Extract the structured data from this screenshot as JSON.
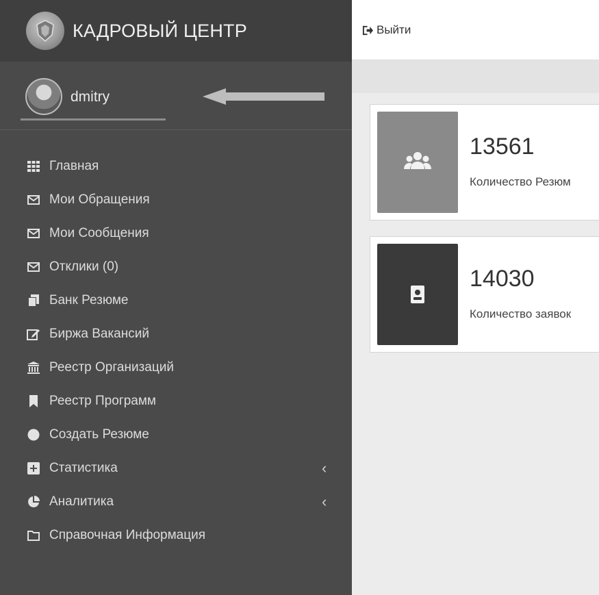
{
  "colors": {
    "sidebar_bg": "#4a4a4a",
    "brand_bg": "#3f3f3f",
    "card1_icon_bg": "#8a8a8a",
    "card2_icon_bg": "#3a3a3a"
  },
  "brand": {
    "title": "КАДРОВЫЙ ЦЕНТР",
    "logo_icon": "emblem-icon"
  },
  "user": {
    "name": "dmitry",
    "avatar_icon": "user-avatar"
  },
  "sidebar": {
    "items": [
      {
        "label": "Главная",
        "icon": "grid-icon",
        "chevron": ""
      },
      {
        "label": "Мои Обращения",
        "icon": "envelope-icon",
        "chevron": ""
      },
      {
        "label": "Мои Сообщения",
        "icon": "envelope-icon",
        "chevron": ""
      },
      {
        "label": "Отклики (0)",
        "icon": "envelope-icon",
        "chevron": ""
      },
      {
        "label": "Банк Резюме",
        "icon": "files-icon",
        "chevron": ""
      },
      {
        "label": "Биржа Вакансий",
        "icon": "edit-icon",
        "chevron": ""
      },
      {
        "label": "Реестр Организаций",
        "icon": "institution-icon",
        "chevron": ""
      },
      {
        "label": "Реестр Программ",
        "icon": "bookmark-icon",
        "chevron": ""
      },
      {
        "label": "Создать Резюме",
        "icon": "circle-icon",
        "chevron": ""
      },
      {
        "label": "Статистика",
        "icon": "plus-square-icon",
        "chevron": "‹"
      },
      {
        "label": "Аналитика",
        "icon": "pie-chart-icon",
        "chevron": "‹"
      },
      {
        "label": "Справочная Информация",
        "icon": "folder-icon",
        "chevron": ""
      }
    ]
  },
  "topbar": {
    "logout_label": "Выйти",
    "logout_icon": "sign-out-icon"
  },
  "cards": [
    {
      "value": "13561",
      "label": "Количество Резюм",
      "icon": "users-icon"
    },
    {
      "value": "14030",
      "label": "Количество заявок",
      "icon": "id-card-icon"
    }
  ]
}
